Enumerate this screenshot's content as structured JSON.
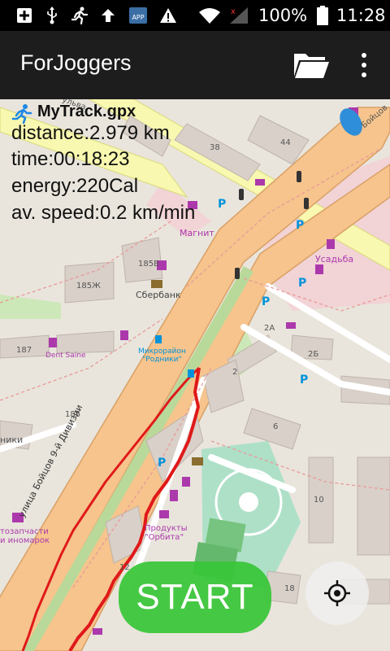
{
  "status_bar": {
    "battery_percent": "100%",
    "time": "11:28",
    "icons": [
      "add-box-icon",
      "usb-icon",
      "running-icon",
      "upload-icon",
      "app-icon",
      "warning-icon",
      "wifi-icon",
      "signal-icon",
      "battery-icon"
    ]
  },
  "app_bar": {
    "title": "ForJoggers",
    "actions": [
      "folder-open-icon",
      "overflow-menu-icon"
    ]
  },
  "track_info": {
    "track_name": "MyTrack.gpx",
    "distance": "distance:2.979 km",
    "time": "time:00:18:23",
    "energy": "energy:220Cal",
    "avg_speed": "av. speed:0.2 km/min"
  },
  "map": {
    "labels": {
      "street_main": "улица Бойцов 9-й Дивизии",
      "magnit": "Магнит",
      "sberbank": "Сбербанк",
      "usadba": "Усадьба",
      "microdistrict": "Микрорайон\n\"Родники\"",
      "dent_saine": "Dent Saine",
      "produkty_orbita": "Продукты\n\"Орбита\"",
      "avtozapchasti": "тозапчасти\nи иномарок",
      "niki": "ники",
      "bld_38": "38",
      "bld_44": "44",
      "bld_185v": "185В",
      "bld_185zh": "185Ж",
      "bld_187": "187",
      "bld_185": "185",
      "bld_2a": "2А",
      "bld_2b": "2Б",
      "bld_2": "2",
      "bld_6": "6",
      "bld_10": "10",
      "bld_18": "18",
      "bld_12": "12",
      "street_top": "Бойцов",
      "street_top2": "ульва"
    },
    "colors": {
      "primary_road": "#f6c48c",
      "secondary_road": "#f8f8b0",
      "track": "#e0191a",
      "park": "#aee0c8"
    }
  },
  "buttons": {
    "start_label": "START",
    "locate_icon": "crosshair-icon"
  }
}
